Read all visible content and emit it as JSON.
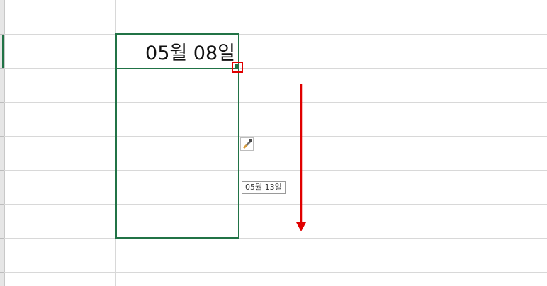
{
  "sheet": {
    "active_cell_value": "05월 08일",
    "autofill_preview": "05월 13일"
  },
  "icons": {
    "fill_handle": "fill-handle-square",
    "autofill_options": "paintbrush-icon",
    "drag_direction": "arrow-down-icon"
  },
  "colors": {
    "selection": "#217346",
    "annotation": "#e00000",
    "gridline": "#d8d8d8"
  }
}
